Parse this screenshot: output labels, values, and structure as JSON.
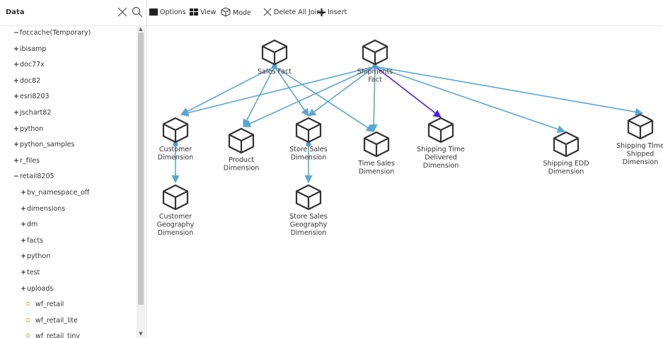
{
  "left_panel": {
    "title": "Data",
    "tree": [
      {
        "toggle": "−",
        "label": "foccache(Temporary)",
        "level": 0
      },
      {
        "toggle": "+",
        "label": "ibisamp",
        "level": 0
      },
      {
        "toggle": "+",
        "label": "doc77x",
        "level": 0
      },
      {
        "toggle": "+",
        "label": "doc82",
        "level": 0
      },
      {
        "toggle": "+",
        "label": "esri8203",
        "level": 0
      },
      {
        "toggle": "+",
        "label": "jschart82",
        "level": 0
      },
      {
        "toggle": "+",
        "label": "python",
        "level": 0
      },
      {
        "toggle": "+",
        "label": "python_samples",
        "level": 0
      },
      {
        "toggle": "+",
        "label": "r_files",
        "level": 0
      },
      {
        "toggle": "−",
        "label": "retail8205",
        "level": 0
      },
      {
        "toggle": "+",
        "label": "bv_namespace_off",
        "level": 1
      },
      {
        "toggle": "+",
        "label": "dimensions",
        "level": 1
      },
      {
        "toggle": "+",
        "label": "dm",
        "level": 1
      },
      {
        "toggle": "+",
        "label": "facts",
        "level": 1
      },
      {
        "toggle": "+",
        "label": "python",
        "level": 1
      },
      {
        "toggle": "+",
        "label": "test",
        "level": 1
      },
      {
        "toggle": "+",
        "label": "uploads",
        "level": 1
      },
      {
        "toggle": "",
        "label": "wf_retail",
        "level": 2,
        "icon": "master-file-icon"
      },
      {
        "toggle": "",
        "label": "wf_retail_lite",
        "level": 2,
        "icon": "master-file-icon"
      },
      {
        "toggle": "",
        "label": "wf_retail_tiny",
        "level": 2,
        "icon": "master-file-icon"
      }
    ]
  },
  "toolbar": {
    "options_label": "Options",
    "view_label": "View",
    "mode_label": "Mode",
    "delete_label": "Delete All Joins",
    "insert_label": "Insert"
  },
  "diagram": {
    "colors": {
      "join": "#5aa6d3",
      "selected_join": "#4a1ff0",
      "cube": "#333333"
    },
    "nodes": [
      {
        "id": "sales_fact",
        "label": [
          "Sales Fact"
        ]
      },
      {
        "id": "shipments_fact",
        "label": [
          "Shipments",
          "Fact"
        ]
      },
      {
        "id": "customer_dim",
        "label": [
          "Customer",
          "Dimension"
        ]
      },
      {
        "id": "product_dim",
        "label": [
          "Product",
          "Dimension"
        ]
      },
      {
        "id": "store_sales_dim",
        "label": [
          "Store Sales",
          "Dimension"
        ]
      },
      {
        "id": "time_sales_dim",
        "label": [
          "Time Sales",
          "Dimension"
        ]
      },
      {
        "id": "ship_time_delivered",
        "label": [
          "Shipping Time",
          "Delivered",
          "Dimension"
        ]
      },
      {
        "id": "ship_edd",
        "label": [
          "Shipping EDD",
          "Dimension"
        ]
      },
      {
        "id": "ship_time_shipped",
        "label": [
          "Shipping Time",
          "Shipped",
          "Dimension"
        ]
      },
      {
        "id": "customer_geo",
        "label": [
          "Customer",
          "Geography",
          "Dimension"
        ]
      },
      {
        "id": "store_sales_geo",
        "label": [
          "Store Sales",
          "Geography",
          "Dimension"
        ]
      }
    ],
    "edges": [
      {
        "from": "sales_fact",
        "to": "customer_dim"
      },
      {
        "from": "sales_fact",
        "to": "product_dim"
      },
      {
        "from": "sales_fact",
        "to": "store_sales_dim"
      },
      {
        "from": "sales_fact",
        "to": "time_sales_dim"
      },
      {
        "from": "shipments_fact",
        "to": "customer_dim"
      },
      {
        "from": "shipments_fact",
        "to": "product_dim"
      },
      {
        "from": "shipments_fact",
        "to": "store_sales_dim"
      },
      {
        "from": "shipments_fact",
        "to": "time_sales_dim"
      },
      {
        "from": "shipments_fact",
        "to": "ship_time_delivered",
        "selected": true
      },
      {
        "from": "shipments_fact",
        "to": "ship_edd"
      },
      {
        "from": "shipments_fact",
        "to": "ship_time_shipped"
      },
      {
        "from": "customer_dim",
        "to": "customer_geo"
      },
      {
        "from": "store_sales_dim",
        "to": "store_sales_geo"
      }
    ]
  }
}
